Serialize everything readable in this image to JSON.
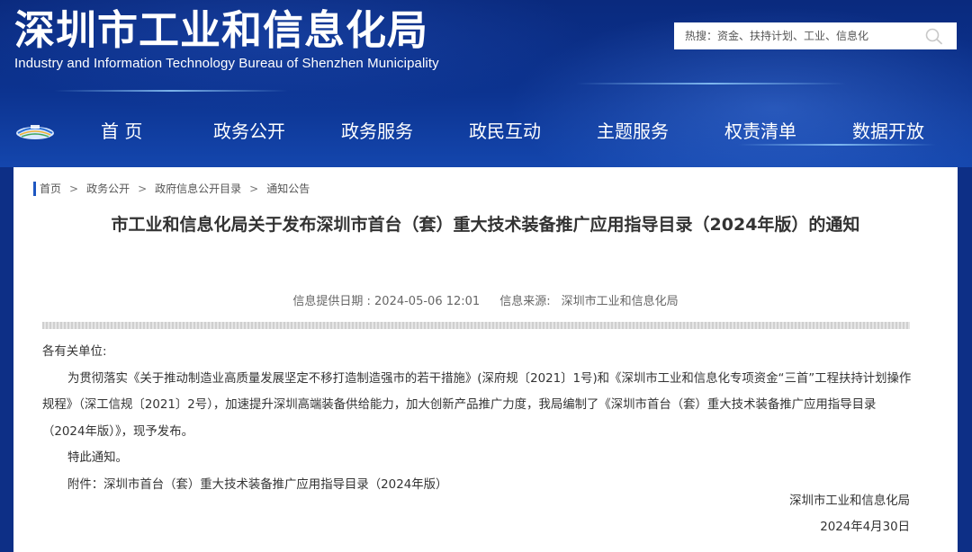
{
  "header": {
    "title": "深圳市工业和信息化局",
    "subtitle": "Industry and Information Technology Bureau of Shenzhen Municipality",
    "search_placeholder": "热搜：资金、扶持计划、工业、信息化"
  },
  "nav": {
    "items": [
      {
        "label": "首 页"
      },
      {
        "label": "政务公开"
      },
      {
        "label": "政务服务"
      },
      {
        "label": "政民互动"
      },
      {
        "label": "主题服务"
      },
      {
        "label": "权责清单"
      },
      {
        "label": "数据开放"
      }
    ]
  },
  "breadcrumb": {
    "items": [
      "首页",
      "政务公开",
      "政府信息公开目录",
      "通知公告"
    ],
    "separator": ">"
  },
  "article": {
    "title": "市工业和信息化局关于发布深圳市首台（套）重大技术装备推广应用指导目录（2024年版）的通知",
    "date_label": "信息提供日期 : 2024-05-06 12:01",
    "source_label": "信息来源:",
    "source_value": "深圳市工业和信息化局",
    "salutation": "各有关单位:",
    "paragraph1": "为贯彻落实《关于推动制造业高质量发展坚定不移打造制造强市的若干措施》(深府规〔2021〕1号)和《深圳市工业和信息化专项资金“三首”工程扶持计划操作规程》（深工信规〔2021〕2号），加速提升深圳高端装备供给能力，加大创新产品推广力度，我局编制了《深圳市首台（套）重大技术装备推广应用指导目录（2024年版）》，现予发布。",
    "closing": "特此通知。",
    "attachment": "附件：深圳市首台（套）重大技术装备推广应用指导目录（2024年版）",
    "signature_org": "深圳市工业和信息化局",
    "signature_date": "2024年4月30日"
  },
  "colors": {
    "header_bg": "#0c3390",
    "accent": "#1d56c1",
    "page_bg": "#ffffff"
  },
  "icons": {
    "search": "search-icon",
    "logo": "site-logo-icon"
  }
}
